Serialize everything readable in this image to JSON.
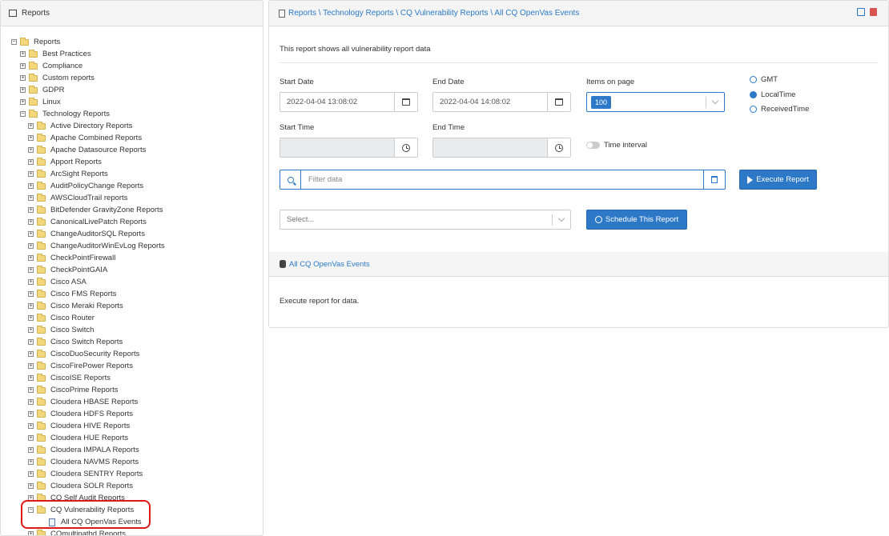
{
  "left": {
    "title": "Reports",
    "tree": [
      {
        "label": "Reports",
        "level": 0,
        "toggle": "−",
        "icon": "folder"
      },
      {
        "label": "Best Practices",
        "level": 1,
        "toggle": "+",
        "icon": "folder"
      },
      {
        "label": "Compliance",
        "level": 1,
        "toggle": "+",
        "icon": "folder"
      },
      {
        "label": "Custom reports",
        "level": 1,
        "toggle": "+",
        "icon": "folder"
      },
      {
        "label": "GDPR",
        "level": 1,
        "toggle": "+",
        "icon": "folder"
      },
      {
        "label": "Linux",
        "level": 1,
        "toggle": "+",
        "icon": "folder"
      },
      {
        "label": "Technology Reports",
        "level": 1,
        "toggle": "−",
        "icon": "folder"
      },
      {
        "label": "Active Directory Reports",
        "level": 2,
        "toggle": "+",
        "icon": "folder"
      },
      {
        "label": "Apache Combined Reports",
        "level": 2,
        "toggle": "+",
        "icon": "folder"
      },
      {
        "label": "Apache Datasource Reports",
        "level": 2,
        "toggle": "+",
        "icon": "folder"
      },
      {
        "label": "Apport Reports",
        "level": 2,
        "toggle": "+",
        "icon": "folder"
      },
      {
        "label": "ArcSight Reports",
        "level": 2,
        "toggle": "+",
        "icon": "folder"
      },
      {
        "label": "AuditPolicyChange Reports",
        "level": 2,
        "toggle": "+",
        "icon": "folder"
      },
      {
        "label": "AWSCloudTrail reports",
        "level": 2,
        "toggle": "+",
        "icon": "folder"
      },
      {
        "label": "BitDefender GravityZone Reports",
        "level": 2,
        "toggle": "+",
        "icon": "folder"
      },
      {
        "label": "CanonicalLivePatch Reports",
        "level": 2,
        "toggle": "+",
        "icon": "folder"
      },
      {
        "label": "ChangeAuditorSQL Reports",
        "level": 2,
        "toggle": "+",
        "icon": "folder"
      },
      {
        "label": "ChangeAuditorWinEvLog Reports",
        "level": 2,
        "toggle": "+",
        "icon": "folder"
      },
      {
        "label": "CheckPointFirewall",
        "level": 2,
        "toggle": "+",
        "icon": "folder"
      },
      {
        "label": "CheckPointGAIA",
        "level": 2,
        "toggle": "+",
        "icon": "folder"
      },
      {
        "label": "Cisco ASA",
        "level": 2,
        "toggle": "+",
        "icon": "folder"
      },
      {
        "label": "Cisco FMS Reports",
        "level": 2,
        "toggle": "+",
        "icon": "folder"
      },
      {
        "label": "Cisco Meraki Reports",
        "level": 2,
        "toggle": "+",
        "icon": "folder"
      },
      {
        "label": "Cisco Router",
        "level": 2,
        "toggle": "+",
        "icon": "folder"
      },
      {
        "label": "Cisco Switch",
        "level": 2,
        "toggle": "+",
        "icon": "folder"
      },
      {
        "label": "Cisco Switch Reports",
        "level": 2,
        "toggle": "+",
        "icon": "folder"
      },
      {
        "label": "CiscoDuoSecurity Reports",
        "level": 2,
        "toggle": "+",
        "icon": "folder"
      },
      {
        "label": "CiscoFirePower Reports",
        "level": 2,
        "toggle": "+",
        "icon": "folder"
      },
      {
        "label": "CiscoISE Reports",
        "level": 2,
        "toggle": "+",
        "icon": "folder"
      },
      {
        "label": "CiscoPrime Reports",
        "level": 2,
        "toggle": "+",
        "icon": "folder"
      },
      {
        "label": "Cloudera HBASE Reports",
        "level": 2,
        "toggle": "+",
        "icon": "folder"
      },
      {
        "label": "Cloudera HDFS Reports",
        "level": 2,
        "toggle": "+",
        "icon": "folder"
      },
      {
        "label": "Cloudera HIVE Reports",
        "level": 2,
        "toggle": "+",
        "icon": "folder"
      },
      {
        "label": "Cloudera HUE Reports",
        "level": 2,
        "toggle": "+",
        "icon": "folder"
      },
      {
        "label": "Cloudera IMPALA Reports",
        "level": 2,
        "toggle": "+",
        "icon": "folder"
      },
      {
        "label": "Cloudera NAVMS Reports",
        "level": 2,
        "toggle": "+",
        "icon": "folder"
      },
      {
        "label": "Cloudera SENTRY Reports",
        "level": 2,
        "toggle": "+",
        "icon": "folder"
      },
      {
        "label": "Cloudera SOLR Reports",
        "level": 2,
        "toggle": "+",
        "icon": "folder"
      },
      {
        "label": "CQ Self Audit Reports",
        "level": 2,
        "toggle": "+",
        "icon": "folder"
      },
      {
        "label": "CQ Vulnerability Reports",
        "level": 2,
        "toggle": "−",
        "icon": "folder"
      },
      {
        "label": "All CQ OpenVas Events",
        "level": 3,
        "toggle": "",
        "icon": "doc"
      },
      {
        "label": "COmultipathd Reports",
        "level": 2,
        "toggle": "+",
        "icon": "folder"
      }
    ]
  },
  "header": {
    "breadcrumb": "Reports \\ Technology Reports \\ CQ Vulnerability Reports \\ All CQ OpenVas Events"
  },
  "form": {
    "description": "This report shows all vulnerability report data",
    "start_date_label": "Start Date",
    "start_date_value": "2022-04-04 13:08:02",
    "end_date_label": "End Date",
    "end_date_value": "2022-04-04 14:08:02",
    "items_label": "Items on page",
    "items_value": "100",
    "timezone_options": [
      "GMT",
      "LocalTime",
      "ReceivedTime"
    ],
    "timezone_selected": "LocalTime",
    "start_time_label": "Start Time",
    "end_time_label": "End Time",
    "time_interval_label": "Time interval",
    "filter_placeholder": "Filter data",
    "execute_label": "Execute Report",
    "select_placeholder": "Select...",
    "schedule_label": "Schedule This Report"
  },
  "results": {
    "title": "All CQ OpenVas Events",
    "message": "Execute report for data."
  },
  "colors": {
    "accent": "#2d79c7",
    "highlight": "#e21818"
  }
}
